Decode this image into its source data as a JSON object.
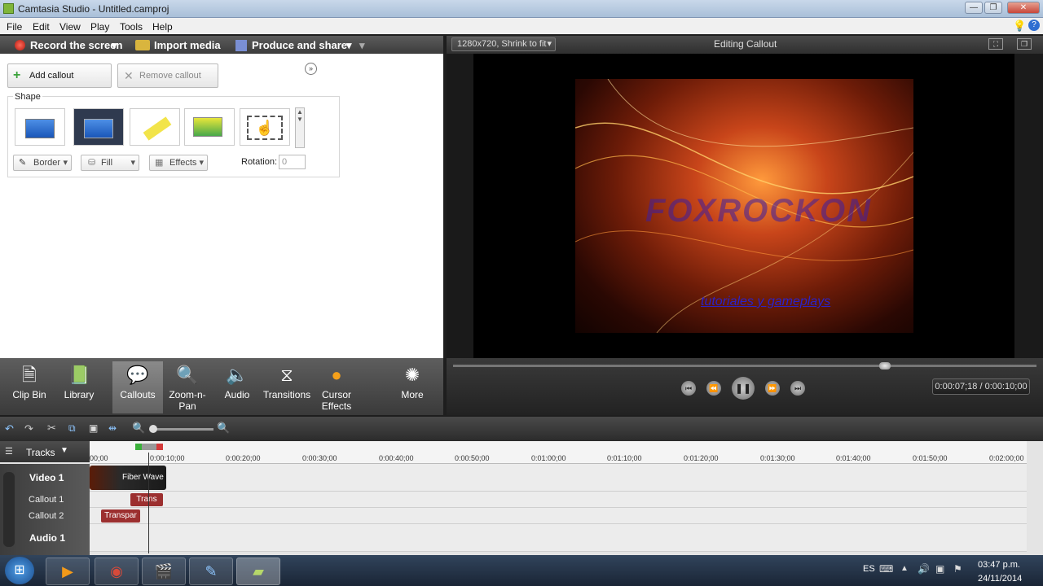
{
  "window": {
    "title": "Camtasia Studio - Untitled.camproj"
  },
  "menu": {
    "items": [
      "File",
      "Edit",
      "View",
      "Play",
      "Tools",
      "Help"
    ]
  },
  "toolbar": {
    "record": "Record the screen",
    "import": "Import media",
    "produce": "Produce and share"
  },
  "callouts": {
    "add": "Add callout",
    "remove": "Remove callout",
    "shape_label": "Shape",
    "border": "Border",
    "fill": "Fill",
    "effects": "Effects",
    "rotation_label": "Rotation:",
    "rotation_value": "0"
  },
  "tasks": [
    "Clip Bin",
    "Library",
    "Callouts",
    "Zoom-n-Pan",
    "Audio",
    "Transitions",
    "Cursor Effects",
    "More"
  ],
  "preview": {
    "size_option": "1280x720, Shrink to fit",
    "title": "Editing Callout",
    "watermark": "FOXROCKON",
    "link_text": "tutoriales y gameplays",
    "time": "0:00:07;18 / 0:00:10;00",
    "progress": 0.74
  },
  "timeline": {
    "tracks_label": "Tracks",
    "ticks": [
      "00;00",
      "0:00:10;00",
      "0:00:20;00",
      "0:00:30;00",
      "0:00:40;00",
      "0:00:50;00",
      "0:01:00;00",
      "0:01:10;00",
      "0:01:20;00",
      "0:01:30;00",
      "0:01:40;00",
      "0:01:50;00",
      "0:02:00;00"
    ],
    "tracks": [
      "Video 1",
      "Callout 1",
      "Callout 2",
      "Audio 1"
    ],
    "clips": {
      "video": "Fiber Wave",
      "callout1": "Trans",
      "callout2": "Transpar"
    }
  },
  "taskbar": {
    "lang": "ES",
    "time": "03:47 p.m.",
    "date": "24/11/2014"
  }
}
